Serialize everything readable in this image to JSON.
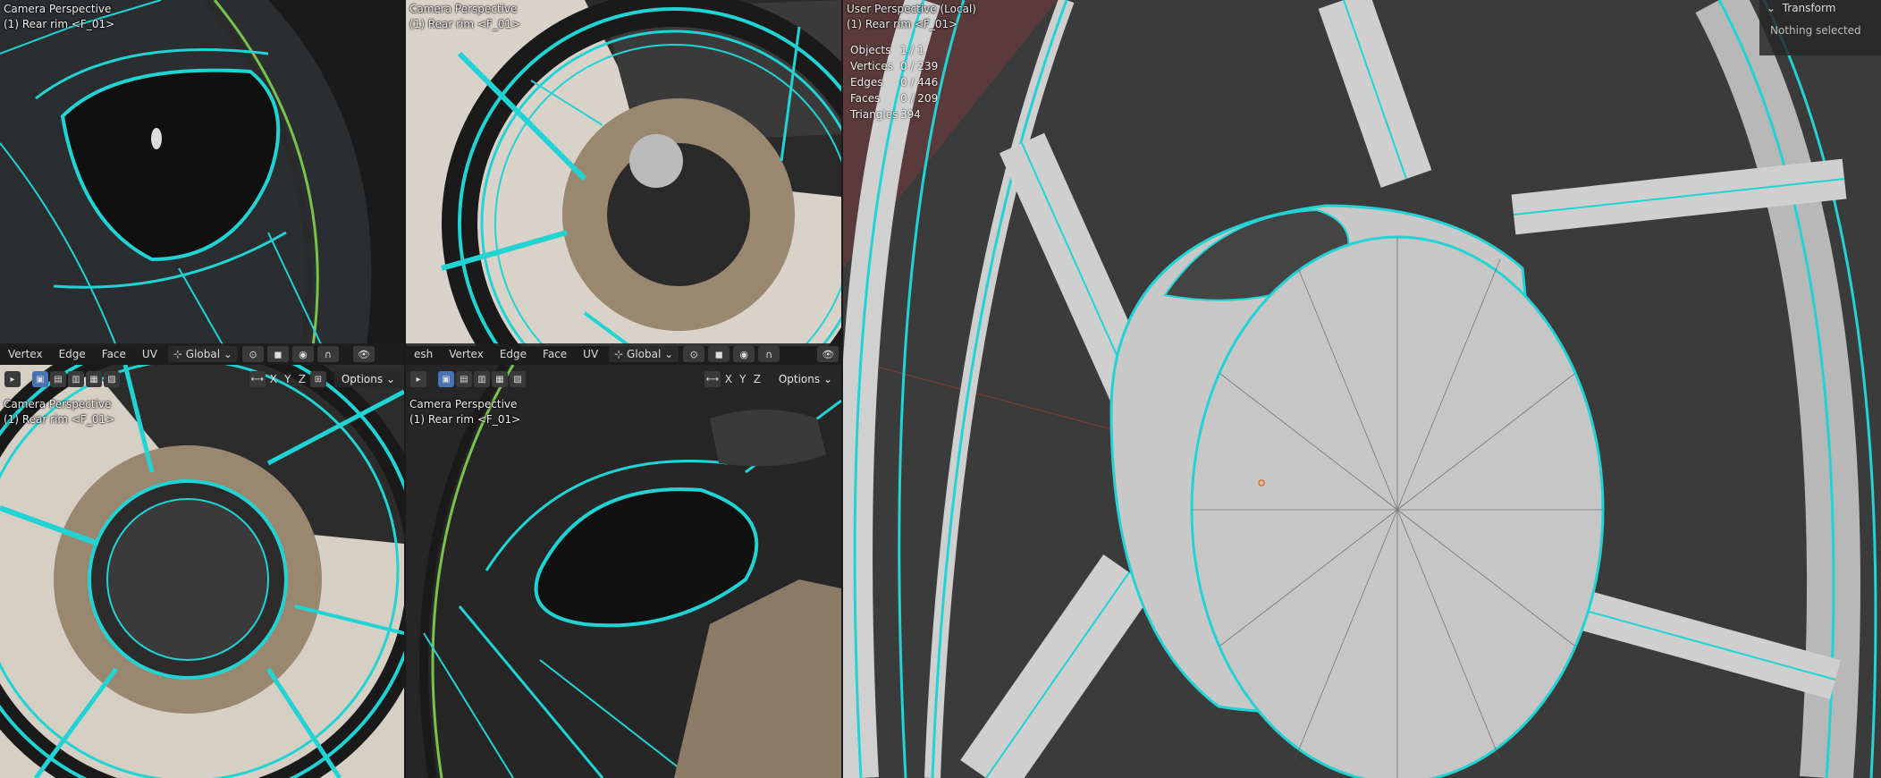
{
  "viewports": {
    "top_left": {
      "title": "Camera Perspective",
      "object": "(1) Rear rim <F_01>"
    },
    "top_mid": {
      "title": "Camera Perspective",
      "object": "(1) Rear rim <F_01>"
    },
    "bottom_left": {
      "title": "Camera Perspective",
      "object": "(1) Rear rim <F_01>"
    },
    "bottom_mid": {
      "title": "Camera Perspective",
      "object": "(1) Rear rim <F_01>"
    },
    "main": {
      "title": "User Perspective (Local)",
      "object": "(1) Rear rim <F_01>"
    }
  },
  "header_left": {
    "menus": [
      "Vertex",
      "Edge",
      "Face",
      "UV"
    ],
    "orientation": "Global",
    "options": "Options",
    "axes": [
      "X",
      "Y",
      "Z"
    ]
  },
  "header_mid": {
    "menus": [
      "esh",
      "Vertex",
      "Edge",
      "Face",
      "UV"
    ],
    "orientation": "Global",
    "options": "Options",
    "axes": [
      "X",
      "Y",
      "Z"
    ]
  },
  "stats": {
    "objects": {
      "label": "Objects",
      "value": "1 / 1"
    },
    "vertices": {
      "label": "Vertices",
      "value": "0 / 239"
    },
    "edges": {
      "label": "Edges",
      "value": "0 / 446"
    },
    "faces": {
      "label": "Faces",
      "value": "0 / 209"
    },
    "triangles": {
      "label": "Triangles",
      "value": "394"
    }
  },
  "npanel": {
    "section": "Transform",
    "empty_text": "Nothing selected"
  },
  "colors": {
    "wire": "#22d3d3",
    "ground": "#3a3a3a",
    "mesh": "#bdbdbd",
    "select": "#4772b3"
  }
}
